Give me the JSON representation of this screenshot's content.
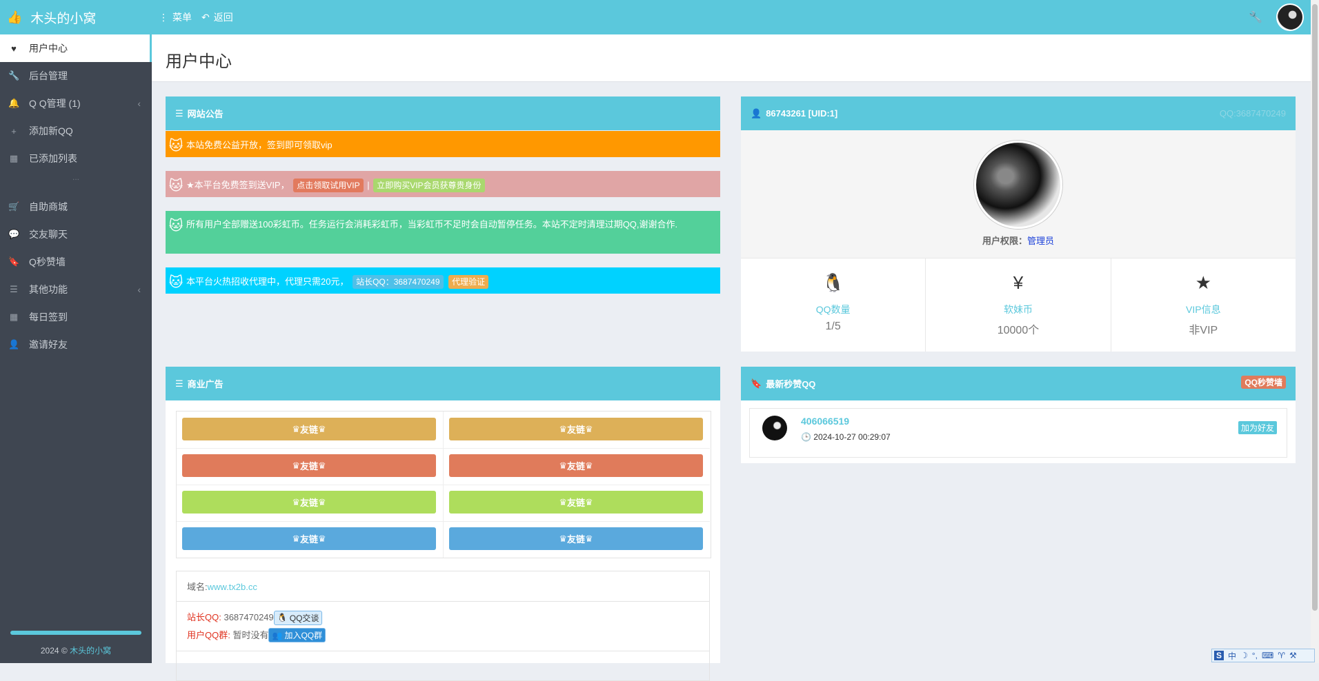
{
  "topbar": {
    "brand_icon": "thumbs-up-icon",
    "brand": "木头的小窝",
    "menu_label": "菜单",
    "back_label": "返回"
  },
  "sidebar": {
    "items": [
      {
        "label": "用户中心",
        "icon": "heart-icon",
        "active": true
      },
      {
        "label": "后台管理",
        "icon": "wrench-icon"
      },
      {
        "label": "Q Q管理 (1)",
        "icon": "bell-icon",
        "has_children": true
      },
      {
        "label": "添加新QQ",
        "icon": "plus-icon"
      },
      {
        "label": "已添加列表",
        "icon": "table-icon"
      },
      {
        "label": "自助商城",
        "icon": "cart-icon"
      },
      {
        "label": "交友聊天",
        "icon": "comment-icon"
      },
      {
        "label": "Q秒赞墙",
        "icon": "bookmark-icon"
      },
      {
        "label": "其他功能",
        "icon": "list-icon",
        "has_children": true
      },
      {
        "label": "每日签到",
        "icon": "table-icon"
      },
      {
        "label": "邀请好友",
        "icon": "user-plus-icon"
      }
    ],
    "ellipsis": "...",
    "copyright_prefix": "2024 ©",
    "copyright_link": "木头的小窝"
  },
  "page": {
    "title": "用户中心"
  },
  "notice": {
    "title": "网站公告",
    "n1": "本站免费公益开放，签到即可领取vip",
    "n2_text": "★本平台免费签到送VIP，",
    "n2_tag1": "点击领取试用VIP",
    "n2_sep": "|",
    "n2_tag2": "立即购买VIP会员获尊贵身份",
    "n3": "所有用户全部赠送100彩虹币。任务运行会消耗彩虹币，当彩虹币不足时会自动暂停任务。本站不定时清理过期QQ,谢谢合作.",
    "n4_text": "本平台火热招收代理中，代理只需20元，",
    "n4_tag1": "站长QQ：3687470249",
    "n4_tag2": "代理验证"
  },
  "user": {
    "header": "86743261 [UID:1]",
    "qq": "QQ:3687470249",
    "perm_label": "用户权限：",
    "perm_value": "管理员",
    "stats": [
      {
        "icon": "penguin-icon",
        "label": "QQ数量",
        "value": "1/5"
      },
      {
        "icon": "yen-icon",
        "label": "软妹币",
        "value": "10000个"
      },
      {
        "icon": "star-icon",
        "label": "VIP信息",
        "value": "非VIP"
      }
    ]
  },
  "ads": {
    "title": "商业广告",
    "link_label": "友链",
    "domain_label": "域名:",
    "domain": "www.tx2b.cc",
    "owner_qq_label": "站长QQ:",
    "owner_qq": "3687470249",
    "qq_chat": "QQ交谈",
    "group_label": "用户QQ群:",
    "group_value": "暂时没有",
    "join_group": "加入QQ群"
  },
  "latest": {
    "title": "最新秒赞QQ",
    "badge": "QQ秒赞墙",
    "qq": "406066519",
    "time": "2024-10-27 00:29:07",
    "add_friend": "加为好友"
  },
  "ime": {
    "s": "S",
    "zh": "中",
    "moon": "☽",
    "dot": "°,",
    "kbd": "⌨",
    "shirt": "♈",
    "wrench": "⚒"
  },
  "colors": {
    "accent": "#5bc8dc",
    "sidebar_bg": "#3f4651",
    "notice_orange": "#ff9800",
    "notice_pink": "#e0a5a5",
    "notice_green": "#53d09a",
    "notice_cyan": "#00d2ff"
  }
}
